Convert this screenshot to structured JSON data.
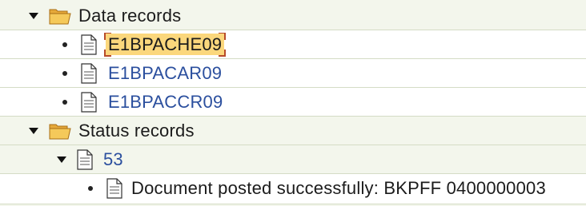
{
  "tree": {
    "data_records": {
      "label": "Data records",
      "children": [
        "E1BPACHE09",
        "E1BPACAR09",
        "E1BPACCR09"
      ],
      "selected": "E1BPACHE09"
    },
    "status_records": {
      "label": "Status records",
      "code": "53",
      "message": "Document posted successfully: BKPFF 0400000003"
    }
  },
  "colors": {
    "selection": "#fbd77c",
    "selection_border": "#b74b2a",
    "link": "#2b4f9e",
    "folder": "#f2c04c"
  },
  "icons": {
    "expanded": "triangle-down-icon",
    "folder": "folder-open-icon",
    "document": "document-icon",
    "leaf": "bullet-icon"
  }
}
